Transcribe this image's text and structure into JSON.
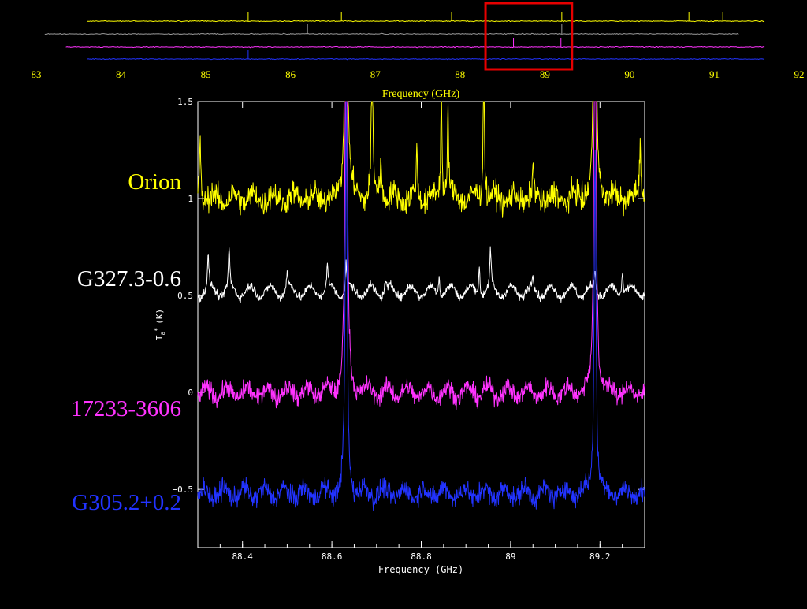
{
  "overview": {
    "xlabel": "Frequency (GHz)",
    "xlim": [
      83,
      92
    ],
    "ticks": [
      83,
      84,
      85,
      86,
      87,
      88,
      89,
      90,
      91,
      92
    ],
    "highlight_range": [
      88.3,
      89.32
    ],
    "colors": {
      "axis_text": "#ffff00",
      "highlight": "#e60000"
    },
    "series": [
      {
        "color": "#ffff00",
        "x_range": [
          83.6,
          91.6
        ]
      },
      {
        "color": "#9a9a9a",
        "x_range": [
          83.1,
          91.3
        ]
      },
      {
        "color": "#ff33ff",
        "x_range": [
          83.35,
          91.6
        ]
      },
      {
        "color": "#2233ff",
        "x_range": [
          83.6,
          91.6
        ]
      }
    ]
  },
  "chart_data": {
    "type": "line",
    "xlabel": "Frequency (GHz)",
    "ylabel": "T",
    "ylabel_sub": "a",
    "ylabel_sup": "*",
    "ylabel_unit": "(K)",
    "xlim": [
      88.3,
      89.3
    ],
    "ylim": [
      -0.8,
      1.5
    ],
    "xticks": [
      88.4,
      88.6,
      88.8,
      89,
      89.2
    ],
    "xtick_labels": [
      "88.4",
      "88.6",
      "88.8",
      "89",
      "89.2"
    ],
    "yticks": [
      -0.5,
      0,
      0.5,
      1,
      1.5
    ],
    "ytick_labels": [
      "−0.5",
      "0",
      "0.5",
      "1",
      "1.5"
    ],
    "strong_lines_ghz": [
      88.632,
      89.189
    ],
    "series": [
      {
        "name": "Orion",
        "color": "#ffff00",
        "baseline": 1.0,
        "noise": 0.055,
        "peaks": [
          {
            "x": 88.305,
            "h": 0.32
          },
          {
            "x": 88.632,
            "h": 2.6
          },
          {
            "x": 88.69,
            "h": 0.9
          },
          {
            "x": 88.71,
            "h": 0.25
          },
          {
            "x": 88.79,
            "h": 0.22
          },
          {
            "x": 88.845,
            "h": 0.55
          },
          {
            "x": 88.86,
            "h": 0.45
          },
          {
            "x": 88.94,
            "h": 0.7
          },
          {
            "x": 89.05,
            "h": 0.15
          },
          {
            "x": 89.189,
            "h": 2.4
          },
          {
            "x": 89.29,
            "h": 0.32
          }
        ]
      },
      {
        "name": "G327.3-0.6",
        "color": "#ffffff",
        "baseline": 0.52,
        "noise": 0.018,
        "peaks": [
          {
            "x": 88.323,
            "h": 0.17
          },
          {
            "x": 88.37,
            "h": 0.2
          },
          {
            "x": 88.5,
            "h": 0.09
          },
          {
            "x": 88.59,
            "h": 0.14
          },
          {
            "x": 88.632,
            "h": 0.14
          },
          {
            "x": 88.72,
            "h": 0.07
          },
          {
            "x": 88.84,
            "h": 0.1
          },
          {
            "x": 88.93,
            "h": 0.14
          },
          {
            "x": 88.955,
            "h": 0.19
          },
          {
            "x": 89.05,
            "h": 0.07
          },
          {
            "x": 89.189,
            "h": 0.1
          },
          {
            "x": 89.25,
            "h": 0.12
          }
        ]
      },
      {
        "name": "17233-3606",
        "color": "#ff33ff",
        "baseline": 0.0,
        "noise": 0.04,
        "peaks": [
          {
            "x": 88.632,
            "h": 2.9
          },
          {
            "x": 89.189,
            "h": 2.7
          }
        ]
      },
      {
        "name": "G305.2+0.2",
        "color": "#2233ff",
        "baseline": -0.52,
        "noise": 0.045,
        "peaks": [
          {
            "x": 88.632,
            "h": 2.0
          },
          {
            "x": 89.189,
            "h": 1.8
          }
        ]
      }
    ]
  }
}
